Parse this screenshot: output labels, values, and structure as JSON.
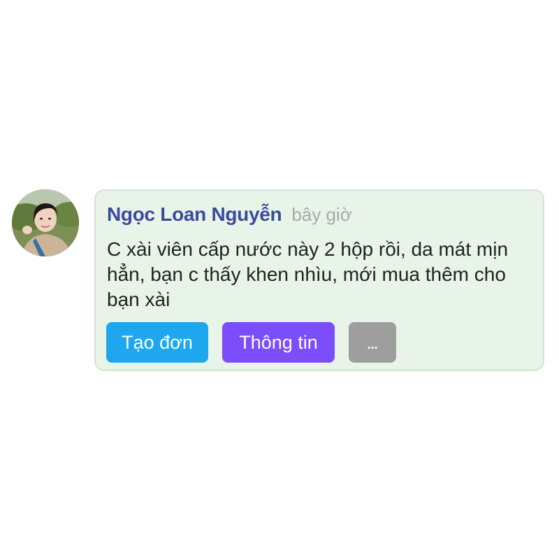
{
  "comment": {
    "author": "Ngọc Loan Nguyễn",
    "timestamp": "bây giờ",
    "text": "C xài viên cấp nước này 2 hộp rồi, da mát mịn hẳn, bạn c thấy khen nhìu, mới mua thêm cho bạn xài"
  },
  "actions": {
    "create_order_label": "Tạo đơn",
    "info_label": "Thông tin",
    "more_label": "..."
  },
  "colors": {
    "card_background": "#e9f4e9",
    "author_name": "#3a4a9f",
    "create_order_button": "#1ea7ee",
    "info_button": "#7c4dfb",
    "more_button": "#9e9e9e"
  },
  "icons": {
    "avatar": "user-photo"
  }
}
